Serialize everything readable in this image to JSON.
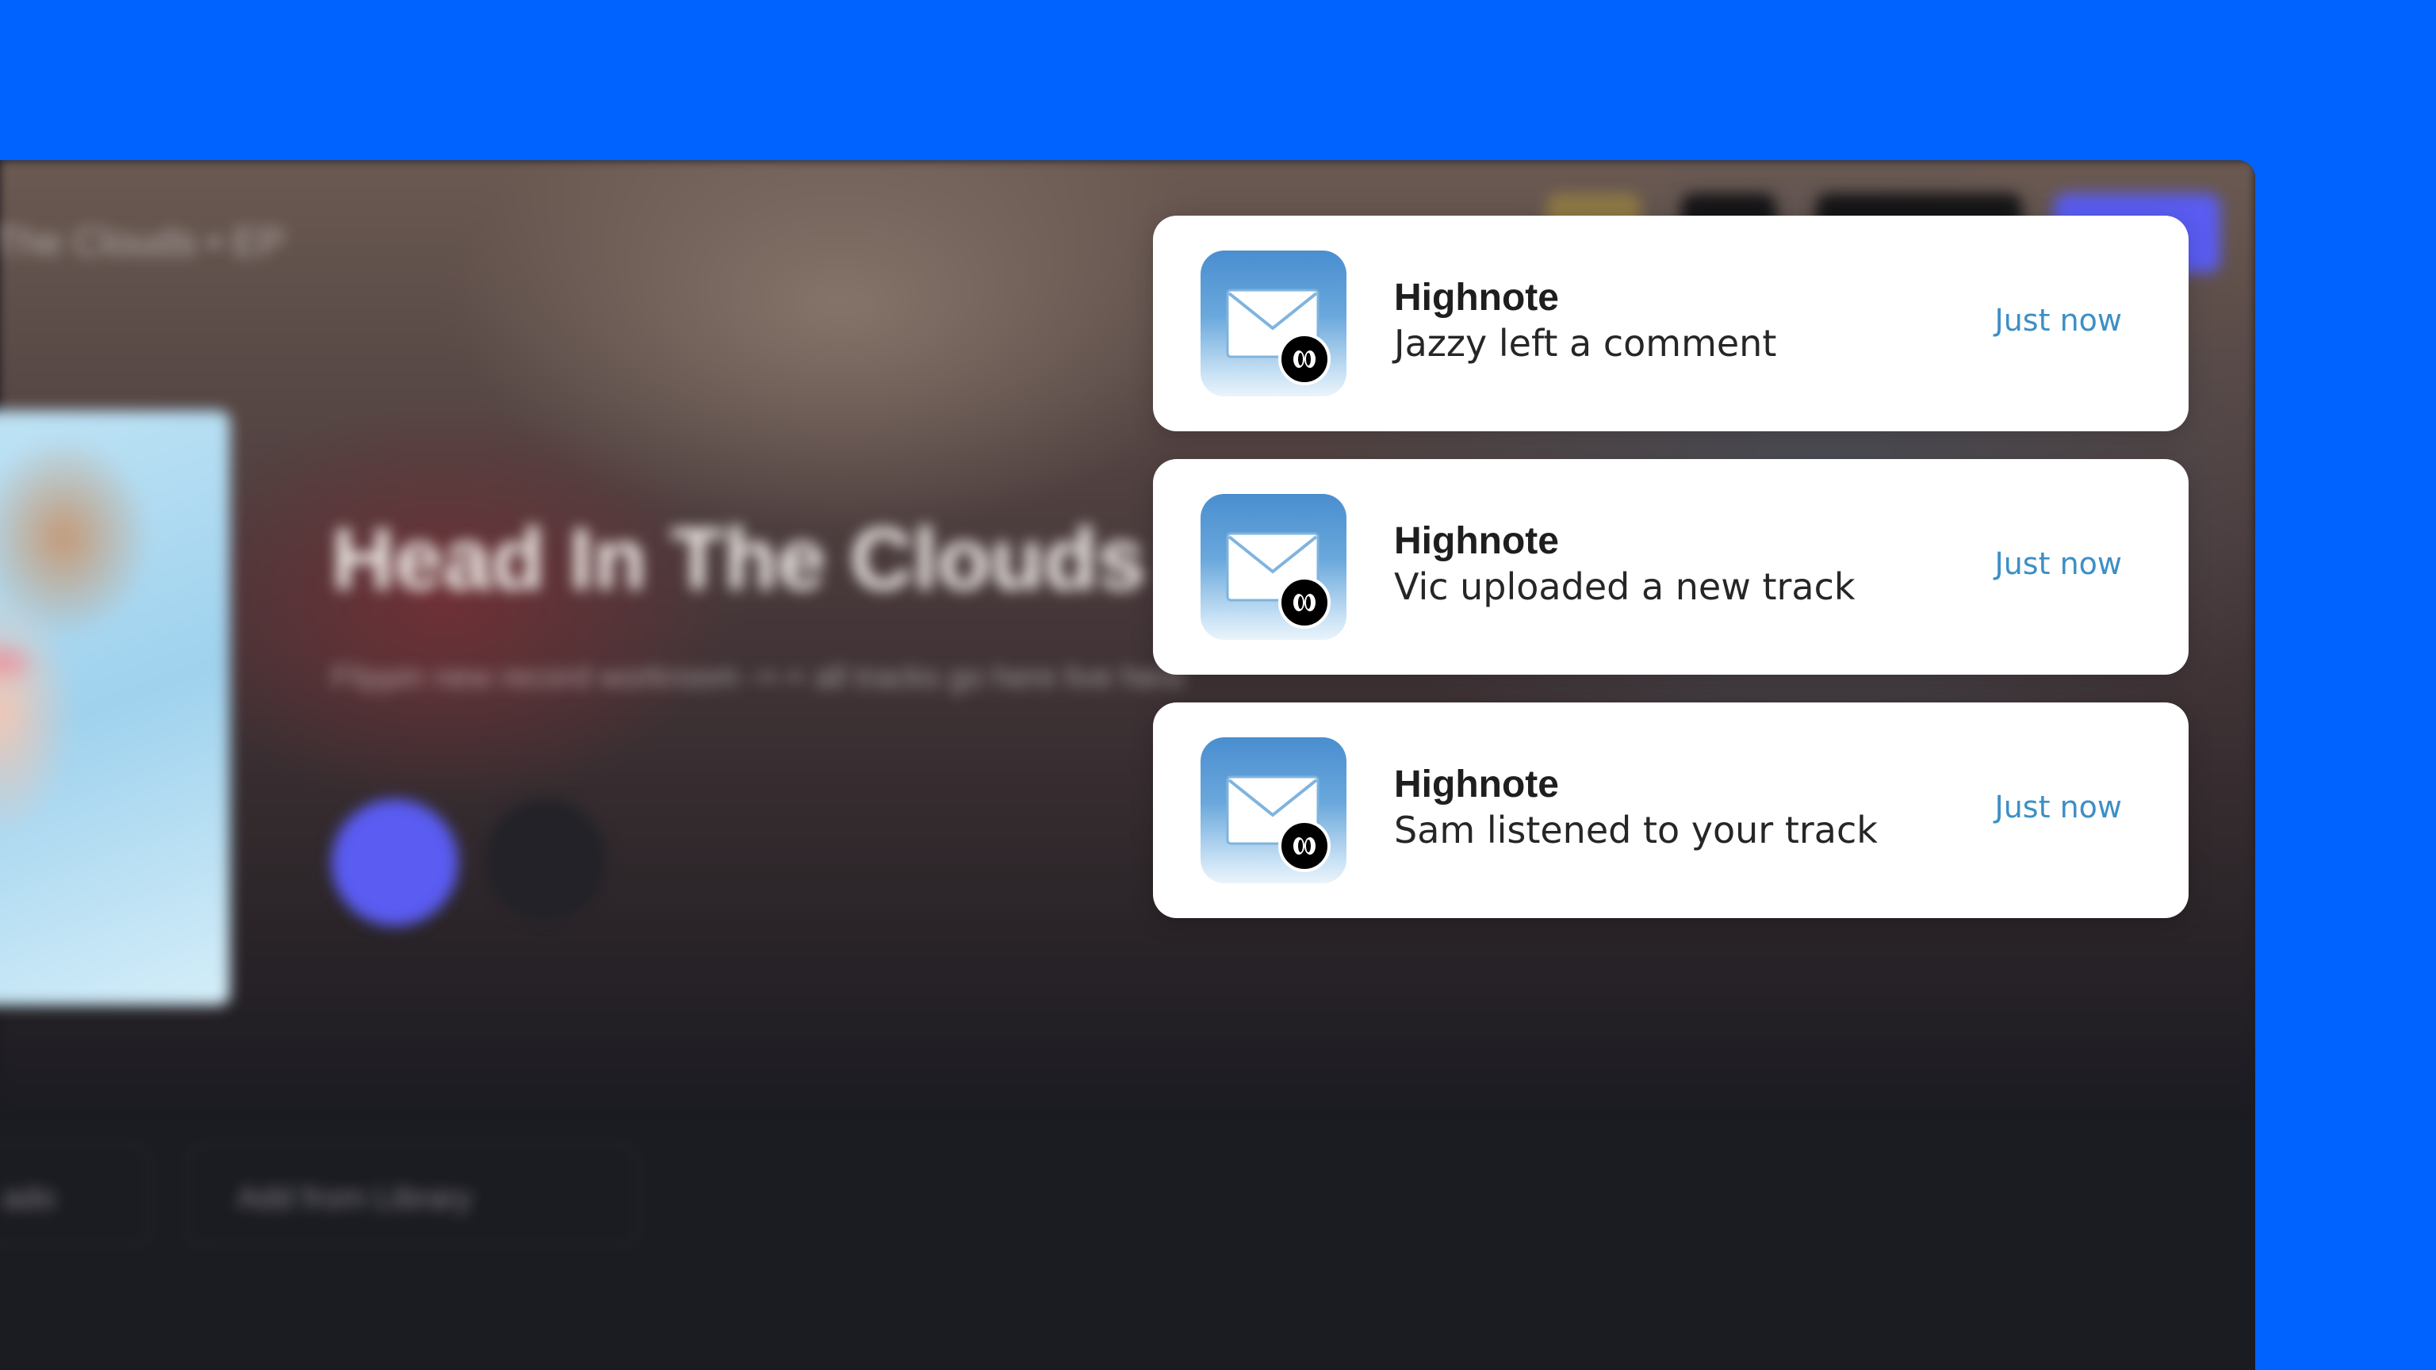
{
  "background": {
    "color": "#0062FF"
  },
  "app": {
    "breadcrumb": "The Clouds • EP",
    "album_title": "Head In The Clouds",
    "album_description": "Flippin new record workroom -+-+ all tracks go here live here",
    "toolbar": {
      "sort_label": "ado",
      "add_from_library_label": "Add from Library"
    }
  },
  "notifications": [
    {
      "app_name": "Highnote",
      "message": "Jazzy left a comment",
      "time": "Just now"
    },
    {
      "app_name": "Highnote",
      "message": "Vic uploaded a new track",
      "time": "Just now"
    },
    {
      "app_name": "Highnote",
      "message": "Sam listened to your track",
      "time": "Just now"
    }
  ],
  "colors": {
    "notification_bg": "#FFFFFF",
    "time_text": "#3D8FC6",
    "play_button": "#5A5CF2"
  },
  "icons": {
    "app_icon": "mail-icon",
    "badge": "highnote-logo-icon"
  }
}
